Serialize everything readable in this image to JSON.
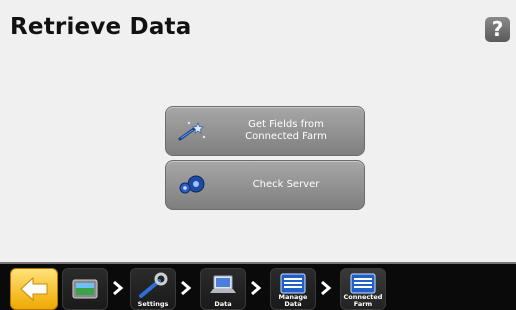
{
  "screen": {
    "title": "Retrieve Data",
    "help_label": "?"
  },
  "buttons": [
    {
      "label": "Get Fields from\nConnected Farm",
      "icon": "wand-icon"
    },
    {
      "label": "Check Server",
      "icon": "gears-icon"
    }
  ],
  "breadcrumb": [
    {
      "label": "",
      "icon": "home-back-icon"
    },
    {
      "label": "",
      "icon": "screen-icon"
    },
    {
      "label": "Settings",
      "icon": "wrench-icon"
    },
    {
      "label": "Data",
      "icon": "laptop-icon"
    },
    {
      "label": "Manage Data",
      "icon": "list-icon"
    },
    {
      "label": "Connected Farm",
      "icon": "list-icon"
    }
  ],
  "colors": {
    "accent": "#f0a800",
    "button": "#8f8f8f",
    "background": "#f0f0f0"
  }
}
